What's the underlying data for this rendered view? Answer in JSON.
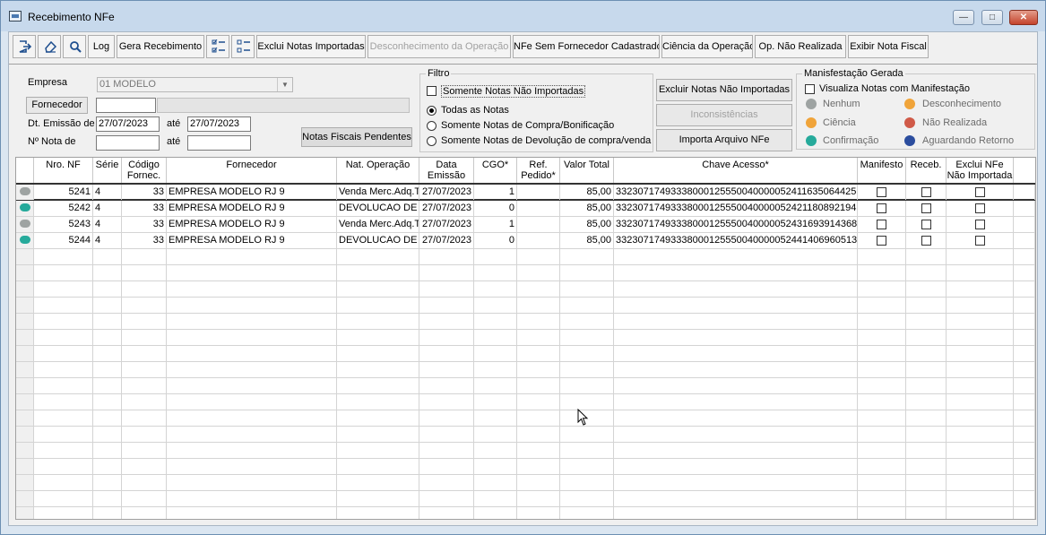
{
  "window": {
    "title": "Recebimento NFe"
  },
  "toolbar": {
    "log": "Log",
    "gera_recebimento": "Gera Recebimento",
    "exclui_notas_importadas": "Exclui Notas Importadas",
    "desconhecimento": "Desconhecimento da Operação",
    "nfe_sem_fornecedor": "NFe Sem Fornecedor Cadastrado",
    "ciencia": "Ciência da Operação",
    "op_nao_realizada": "Op. Não Realizada",
    "exibir_nota": "Exibir Nota Fiscal"
  },
  "form": {
    "empresa_label": "Empresa",
    "empresa_value": "01 MODELO",
    "fornecedor_button": "Fornecedor",
    "fornecedor_code": "",
    "fornecedor_name": "",
    "dt_emissao_label": "Dt. Emissão de",
    "dt_emissao_de": "27/07/2023",
    "ate_label": "até",
    "dt_emissao_ate": "27/07/2023",
    "nota_label": "Nº Nota de",
    "nota_de": "",
    "nota_ate_label": "até",
    "nota_ate": "",
    "pendentes_button": "Notas Fiscais Pendentes"
  },
  "filtro": {
    "title": "Filtro",
    "somente_nao_importadas": "Somente Notas Não Importadas",
    "todas": "Todas as Notas",
    "compra": "Somente Notas de Compra/Bonificação",
    "devolucao": "Somente Notas de Devolução de compra/venda"
  },
  "actions": {
    "excluir_nao_importadas": "Excluir Notas Não Importadas",
    "inconsistencias": "Inconsistências",
    "importa_arquivo": "Importa Arquivo NFe"
  },
  "manifestacao": {
    "title": "Manisfestação Gerada",
    "visualiza": "Visualiza Notas com Manifestação",
    "nenhum": "Nenhum",
    "desconhecimento": "Desconhecimento",
    "ciencia": "Ciência",
    "nao_realizada": "Não Realizada",
    "confirmacao": "Confirmação",
    "aguardando": "Aguardando Retorno",
    "colors": {
      "nenhum": "#9ea3a2",
      "desconhecimento": "#f0a43a",
      "ciencia": "#f0a43a",
      "nao_realizada": "#d05a48",
      "confirmacao": "#26aa9b",
      "aguardando": "#2b4d9e"
    }
  },
  "grid": {
    "headers": {
      "nro_nf": "Nro. NF",
      "serie": "Série",
      "codigo_1": "Código",
      "codigo_2": "Fornec.",
      "fornecedor": "Fornecedor",
      "nat_operacao": "Nat. Operação",
      "data_1": "Data",
      "data_2": "Emissão",
      "cgo": "CGO*",
      "ref_1": "Ref.",
      "ref_2": "Pedido*",
      "valor_total": "Valor Total",
      "chave": "Chave Acesso*",
      "manifesto": "Manifesto",
      "receb": "Receb.",
      "exclui_1": "Exclui NFe",
      "exclui_2": "Não Importada"
    },
    "rows": [
      {
        "status_color": "#9ea3a2",
        "nro": "5241",
        "serie": "4",
        "codigo": "33",
        "fornecedor": "EMPRESA MODELO RJ 9",
        "nat": "Venda Merc.Adq.T",
        "data": "27/07/2023",
        "cgo": "1",
        "ref": "",
        "valor": "85,00",
        "chave": "33230717493338000125550040000052411635064425"
      },
      {
        "status_color": "#26aa9b",
        "nro": "5242",
        "serie": "4",
        "codigo": "33",
        "fornecedor": "EMPRESA MODELO RJ 9",
        "nat": "DEVOLUCAO DE",
        "data": "27/07/2023",
        "cgo": "0",
        "ref": "",
        "valor": "85,00",
        "chave": "33230717493338000125550040000052421180892194"
      },
      {
        "status_color": "#9ea3a2",
        "nro": "5243",
        "serie": "4",
        "codigo": "33",
        "fornecedor": "EMPRESA MODELO RJ 9",
        "nat": "Venda Merc.Adq.T",
        "data": "27/07/2023",
        "cgo": "1",
        "ref": "",
        "valor": "85,00",
        "chave": "33230717493338000125550040000052431693914368"
      },
      {
        "status_color": "#26aa9b",
        "nro": "5244",
        "serie": "4",
        "codigo": "33",
        "fornecedor": "EMPRESA MODELO RJ 9",
        "nat": "DEVOLUCAO DE",
        "data": "27/07/2023",
        "cgo": "0",
        "ref": "",
        "valor": "85,00",
        "chave": "33230717493338000125550040000052441406960513"
      }
    ]
  }
}
